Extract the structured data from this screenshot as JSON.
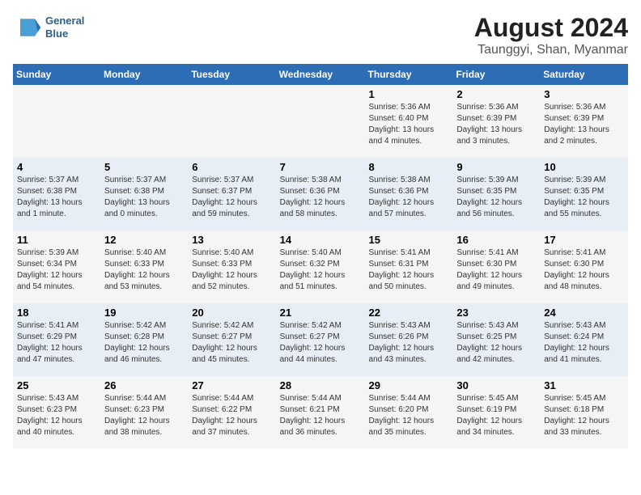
{
  "logo": {
    "line1": "General",
    "line2": "Blue"
  },
  "title": "August 2024",
  "subtitle": "Taunggyi, Shan, Myanmar",
  "headers": [
    "Sunday",
    "Monday",
    "Tuesday",
    "Wednesday",
    "Thursday",
    "Friday",
    "Saturday"
  ],
  "weeks": [
    [
      {
        "day": "",
        "info": ""
      },
      {
        "day": "",
        "info": ""
      },
      {
        "day": "",
        "info": ""
      },
      {
        "day": "",
        "info": ""
      },
      {
        "day": "1",
        "info": "Sunrise: 5:36 AM\nSunset: 6:40 PM\nDaylight: 13 hours\nand 4 minutes."
      },
      {
        "day": "2",
        "info": "Sunrise: 5:36 AM\nSunset: 6:39 PM\nDaylight: 13 hours\nand 3 minutes."
      },
      {
        "day": "3",
        "info": "Sunrise: 5:36 AM\nSunset: 6:39 PM\nDaylight: 13 hours\nand 2 minutes."
      }
    ],
    [
      {
        "day": "4",
        "info": "Sunrise: 5:37 AM\nSunset: 6:38 PM\nDaylight: 13 hours\nand 1 minute."
      },
      {
        "day": "5",
        "info": "Sunrise: 5:37 AM\nSunset: 6:38 PM\nDaylight: 13 hours\nand 0 minutes."
      },
      {
        "day": "6",
        "info": "Sunrise: 5:37 AM\nSunset: 6:37 PM\nDaylight: 12 hours\nand 59 minutes."
      },
      {
        "day": "7",
        "info": "Sunrise: 5:38 AM\nSunset: 6:36 PM\nDaylight: 12 hours\nand 58 minutes."
      },
      {
        "day": "8",
        "info": "Sunrise: 5:38 AM\nSunset: 6:36 PM\nDaylight: 12 hours\nand 57 minutes."
      },
      {
        "day": "9",
        "info": "Sunrise: 5:39 AM\nSunset: 6:35 PM\nDaylight: 12 hours\nand 56 minutes."
      },
      {
        "day": "10",
        "info": "Sunrise: 5:39 AM\nSunset: 6:35 PM\nDaylight: 12 hours\nand 55 minutes."
      }
    ],
    [
      {
        "day": "11",
        "info": "Sunrise: 5:39 AM\nSunset: 6:34 PM\nDaylight: 12 hours\nand 54 minutes."
      },
      {
        "day": "12",
        "info": "Sunrise: 5:40 AM\nSunset: 6:33 PM\nDaylight: 12 hours\nand 53 minutes."
      },
      {
        "day": "13",
        "info": "Sunrise: 5:40 AM\nSunset: 6:33 PM\nDaylight: 12 hours\nand 52 minutes."
      },
      {
        "day": "14",
        "info": "Sunrise: 5:40 AM\nSunset: 6:32 PM\nDaylight: 12 hours\nand 51 minutes."
      },
      {
        "day": "15",
        "info": "Sunrise: 5:41 AM\nSunset: 6:31 PM\nDaylight: 12 hours\nand 50 minutes."
      },
      {
        "day": "16",
        "info": "Sunrise: 5:41 AM\nSunset: 6:30 PM\nDaylight: 12 hours\nand 49 minutes."
      },
      {
        "day": "17",
        "info": "Sunrise: 5:41 AM\nSunset: 6:30 PM\nDaylight: 12 hours\nand 48 minutes."
      }
    ],
    [
      {
        "day": "18",
        "info": "Sunrise: 5:41 AM\nSunset: 6:29 PM\nDaylight: 12 hours\nand 47 minutes."
      },
      {
        "day": "19",
        "info": "Sunrise: 5:42 AM\nSunset: 6:28 PM\nDaylight: 12 hours\nand 46 minutes."
      },
      {
        "day": "20",
        "info": "Sunrise: 5:42 AM\nSunset: 6:27 PM\nDaylight: 12 hours\nand 45 minutes."
      },
      {
        "day": "21",
        "info": "Sunrise: 5:42 AM\nSunset: 6:27 PM\nDaylight: 12 hours\nand 44 minutes."
      },
      {
        "day": "22",
        "info": "Sunrise: 5:43 AM\nSunset: 6:26 PM\nDaylight: 12 hours\nand 43 minutes."
      },
      {
        "day": "23",
        "info": "Sunrise: 5:43 AM\nSunset: 6:25 PM\nDaylight: 12 hours\nand 42 minutes."
      },
      {
        "day": "24",
        "info": "Sunrise: 5:43 AM\nSunset: 6:24 PM\nDaylight: 12 hours\nand 41 minutes."
      }
    ],
    [
      {
        "day": "25",
        "info": "Sunrise: 5:43 AM\nSunset: 6:23 PM\nDaylight: 12 hours\nand 40 minutes."
      },
      {
        "day": "26",
        "info": "Sunrise: 5:44 AM\nSunset: 6:23 PM\nDaylight: 12 hours\nand 38 minutes."
      },
      {
        "day": "27",
        "info": "Sunrise: 5:44 AM\nSunset: 6:22 PM\nDaylight: 12 hours\nand 37 minutes."
      },
      {
        "day": "28",
        "info": "Sunrise: 5:44 AM\nSunset: 6:21 PM\nDaylight: 12 hours\nand 36 minutes."
      },
      {
        "day": "29",
        "info": "Sunrise: 5:44 AM\nSunset: 6:20 PM\nDaylight: 12 hours\nand 35 minutes."
      },
      {
        "day": "30",
        "info": "Sunrise: 5:45 AM\nSunset: 6:19 PM\nDaylight: 12 hours\nand 34 minutes."
      },
      {
        "day": "31",
        "info": "Sunrise: 5:45 AM\nSunset: 6:18 PM\nDaylight: 12 hours\nand 33 minutes."
      }
    ]
  ]
}
